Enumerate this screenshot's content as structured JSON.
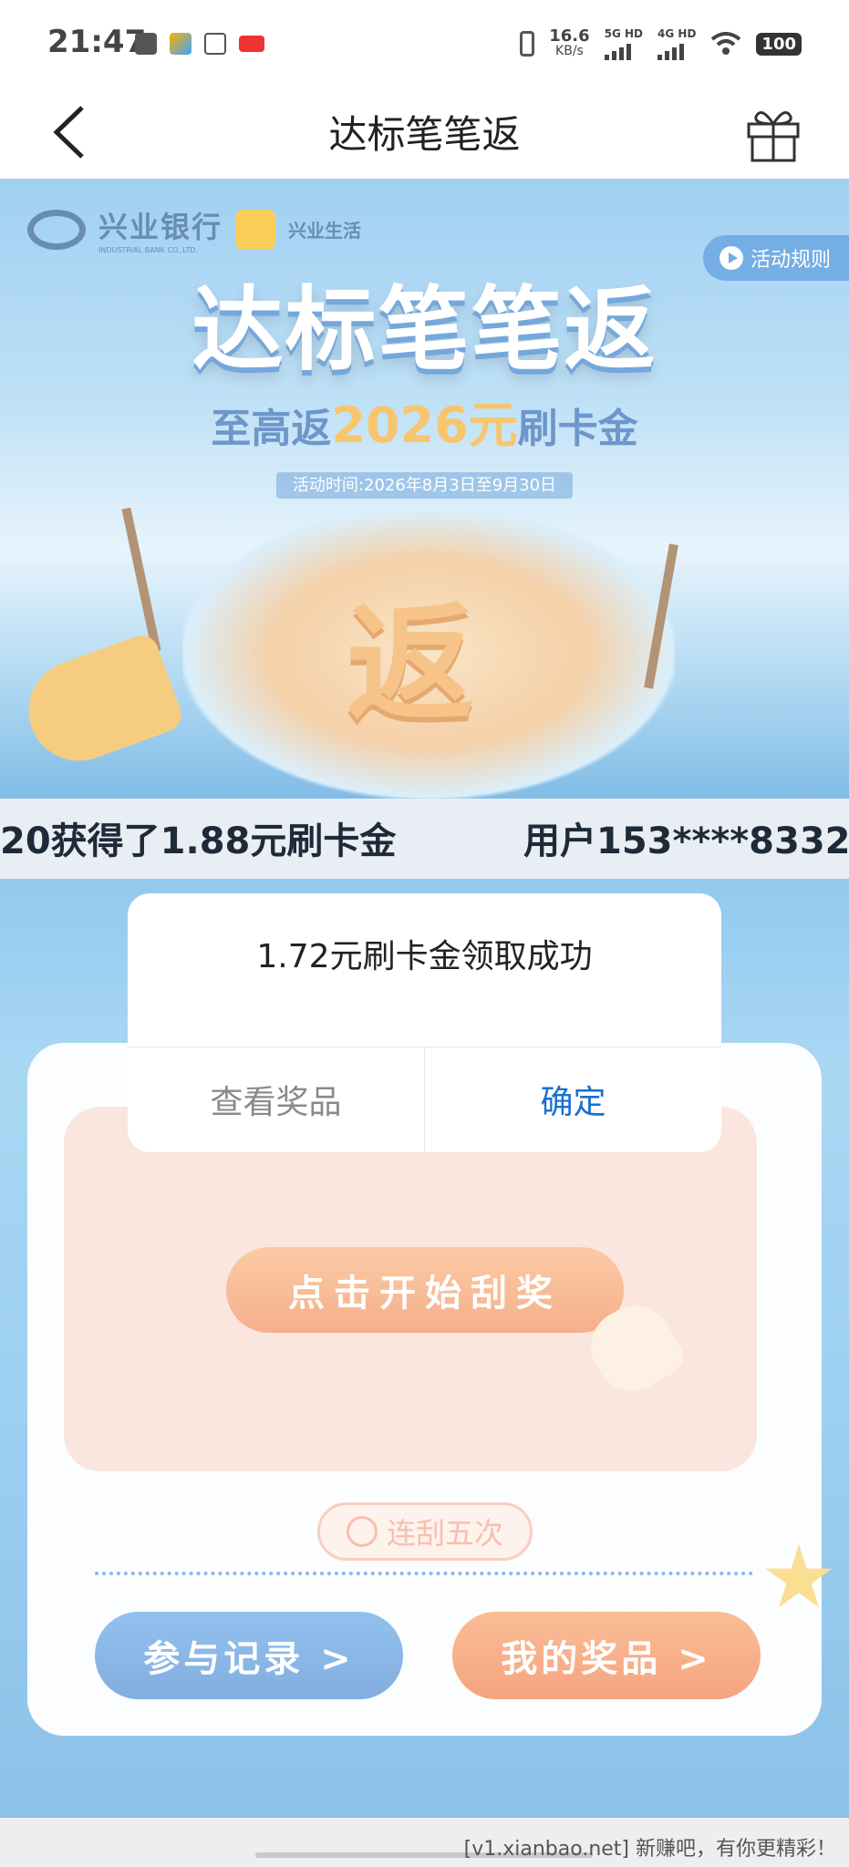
{
  "status_bar": {
    "time": "21:47",
    "net_speed_value": "16.6",
    "net_speed_unit": "KB/s",
    "sig1_label": "5G HD",
    "sig2_label": "4G HD",
    "battery": "100"
  },
  "topbar": {
    "title": "达标笔笔返"
  },
  "banner": {
    "bank_name": "兴业银行",
    "bank_sub": "INDUSTRIAL BANK CO.,LTD.",
    "life_name": "兴业生活",
    "rules_label": "活动规则",
    "title": "达标笔笔返",
    "subtitle_pre": "至高返",
    "subtitle_amount": "2026元",
    "subtitle_post": "刷卡金",
    "date": "活动时间:2026年8月3日至9月30日",
    "center_char": "返"
  },
  "ticker": {
    "items": [
      "20获得了1.88元刷卡金",
      "用户153****8332"
    ]
  },
  "game": {
    "start_label": "点击开始刮奖",
    "five_label": "连刮五次",
    "records_label": "参与记录 >",
    "prizes_label": "我的奖品 >"
  },
  "dialog": {
    "message": "1.72元刷卡金领取成功",
    "view_label": "查看奖品",
    "ok_label": "确定"
  },
  "footer": {
    "text": "[v1.xianbao.net] 新赚吧，有你更精彩！"
  }
}
